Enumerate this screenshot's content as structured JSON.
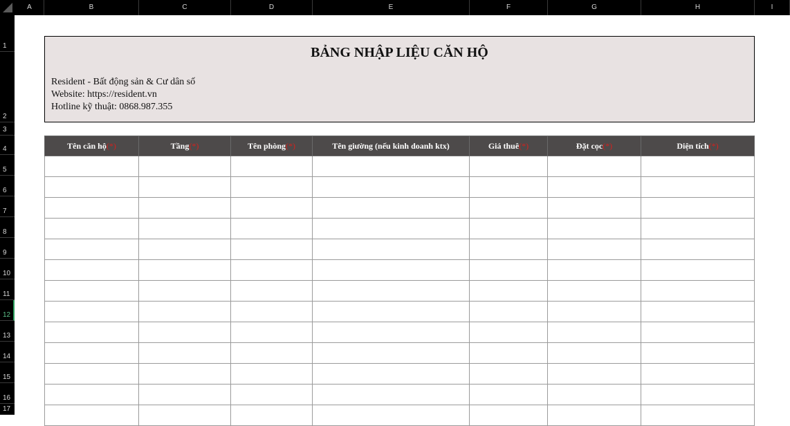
{
  "column_headers": [
    "A",
    "B",
    "C",
    "D",
    "E",
    "F",
    "G",
    "H",
    "I"
  ],
  "row_headers": [
    "1",
    "2",
    "3",
    "4",
    "5",
    "6",
    "7",
    "8",
    "9",
    "10",
    "11",
    "12",
    "13",
    "14",
    "15",
    "16",
    "17"
  ],
  "active_row": "12",
  "info": {
    "title": "BẢNG NHẬP LIỆU CĂN HỘ",
    "line1": "Resident - Bất động sản & Cư dân số",
    "line2": "Website: https://resident.vn",
    "line3": "Hotline kỹ thuật: 0868.987.355"
  },
  "table": {
    "required_marker": "(*)",
    "headers": [
      {
        "label": "Tên căn hộ",
        "required": true
      },
      {
        "label": "Tầng",
        "required": true
      },
      {
        "label": "Tên phòng",
        "required": true
      },
      {
        "label": "Tên giường (nếu kinh doanh ktx)",
        "required": false
      },
      {
        "label": "Giá thuê",
        "required": true
      },
      {
        "label": "Đặt cọc",
        "required": true
      },
      {
        "label": "Diện tích",
        "required": true
      }
    ],
    "empty_rows": 13
  },
  "colors": {
    "header_bg": "#4d4a4a",
    "required_marker": "#d4211e",
    "info_bg": "#e8e2e2"
  }
}
